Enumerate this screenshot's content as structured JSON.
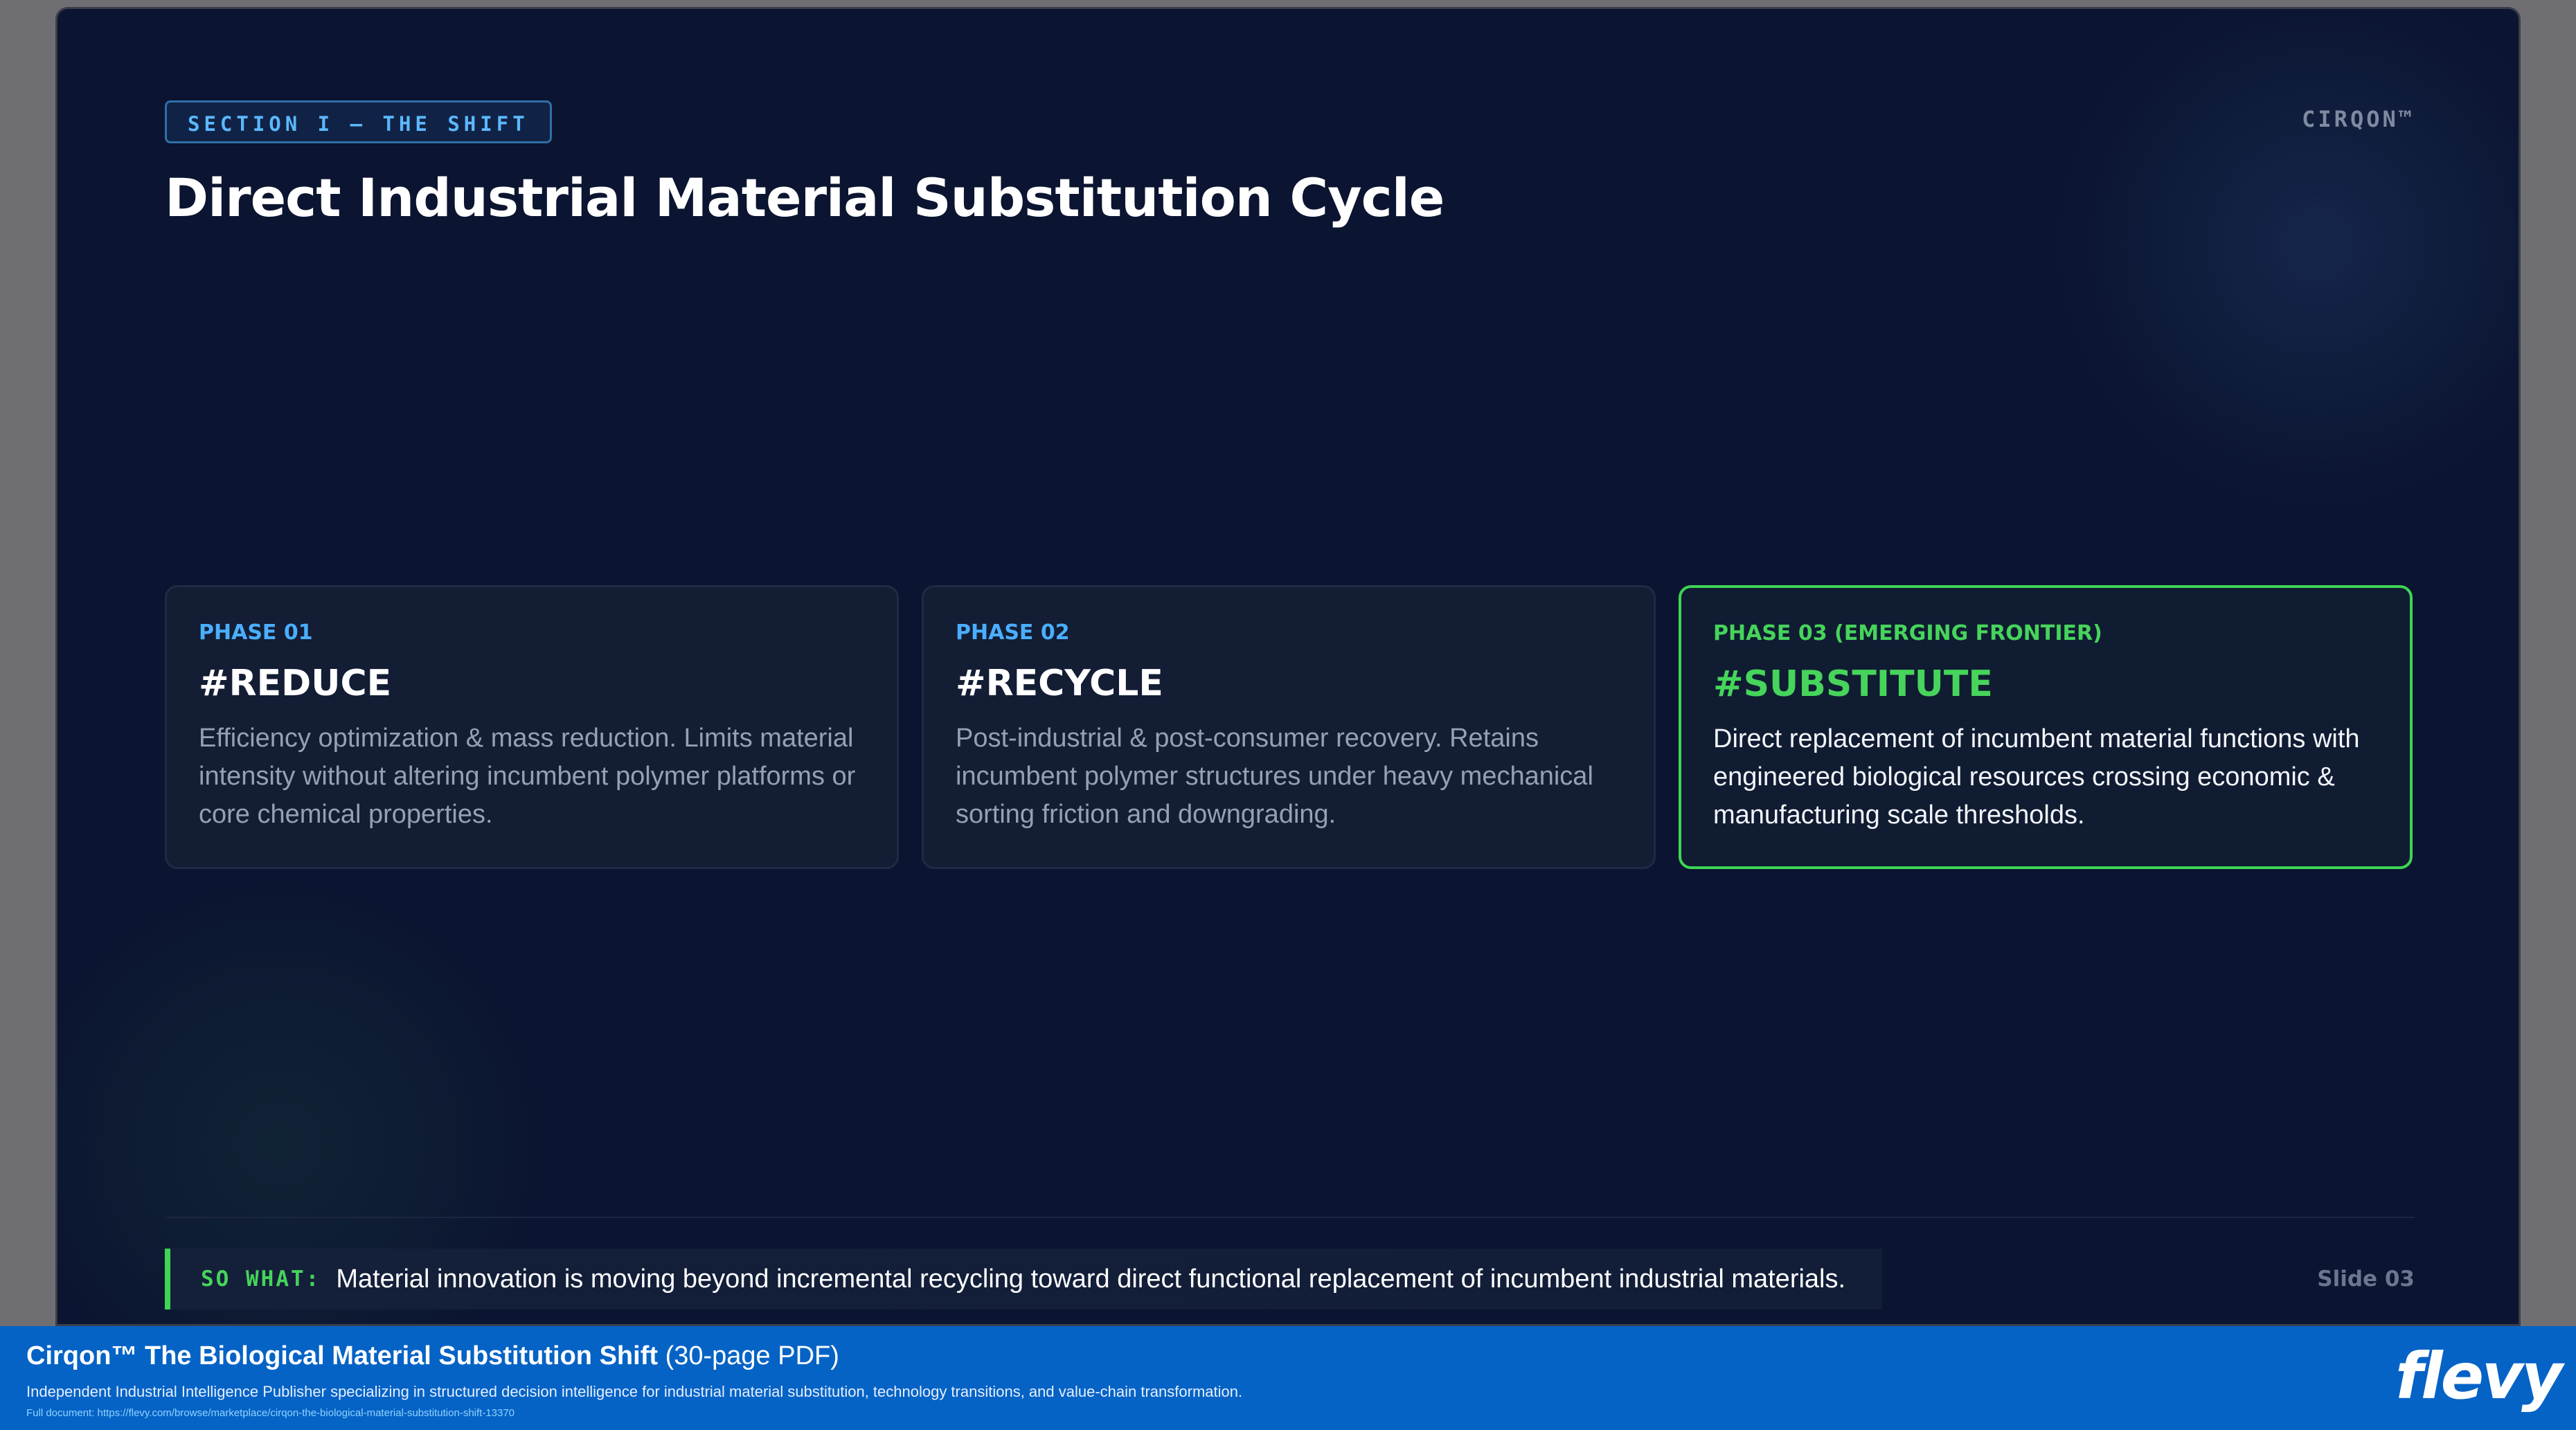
{
  "slide": {
    "section_tag": "SECTION I — THE SHIFT",
    "brand": "CIRQON™",
    "title": "Direct Industrial Material Substitution Cycle",
    "cards": [
      {
        "phase": "PHASE 01",
        "tag": "#REDUCE",
        "description": "Efficiency optimization & mass reduction. Limits material intensity without altering incumbent polymer platforms or core chemical properties."
      },
      {
        "phase": "PHASE 02",
        "tag": "#RECYCLE",
        "description": "Post-industrial & post-consumer recovery. Retains incumbent polymer structures under heavy mechanical sorting friction and downgrading."
      },
      {
        "phase": "PHASE 03 (EMERGING FRONTIER)",
        "tag": "#SUBSTITUTE",
        "description": "Direct replacement of incumbent material functions with engineered biological resources crossing economic & manufacturing scale thresholds."
      }
    ],
    "so_what_label": "SO WHAT:",
    "so_what_text": "Material innovation is moving beyond incremental recycling toward direct functional replacement of incumbent industrial materials.",
    "slide_number": "Slide 03"
  },
  "footer": {
    "title_bold": "Cirqon™ The Biological Material Substitution Shift",
    "title_light": "(30-page PDF)",
    "subtitle": "Independent Industrial Intelligence Publisher specializing in structured decision intelligence for industrial material substitution, technology transitions, and value-chain transformation.",
    "link": "Full document: https://flevy.com/browse/marketplace/cirqon-the-biological-material-substitution-shift-13370",
    "logo": "flevy"
  },
  "colors": {
    "background": "#0b1430",
    "accent_blue": "#4aaeff",
    "accent_green": "#46d45b",
    "footer_blue": "#0563c6"
  }
}
